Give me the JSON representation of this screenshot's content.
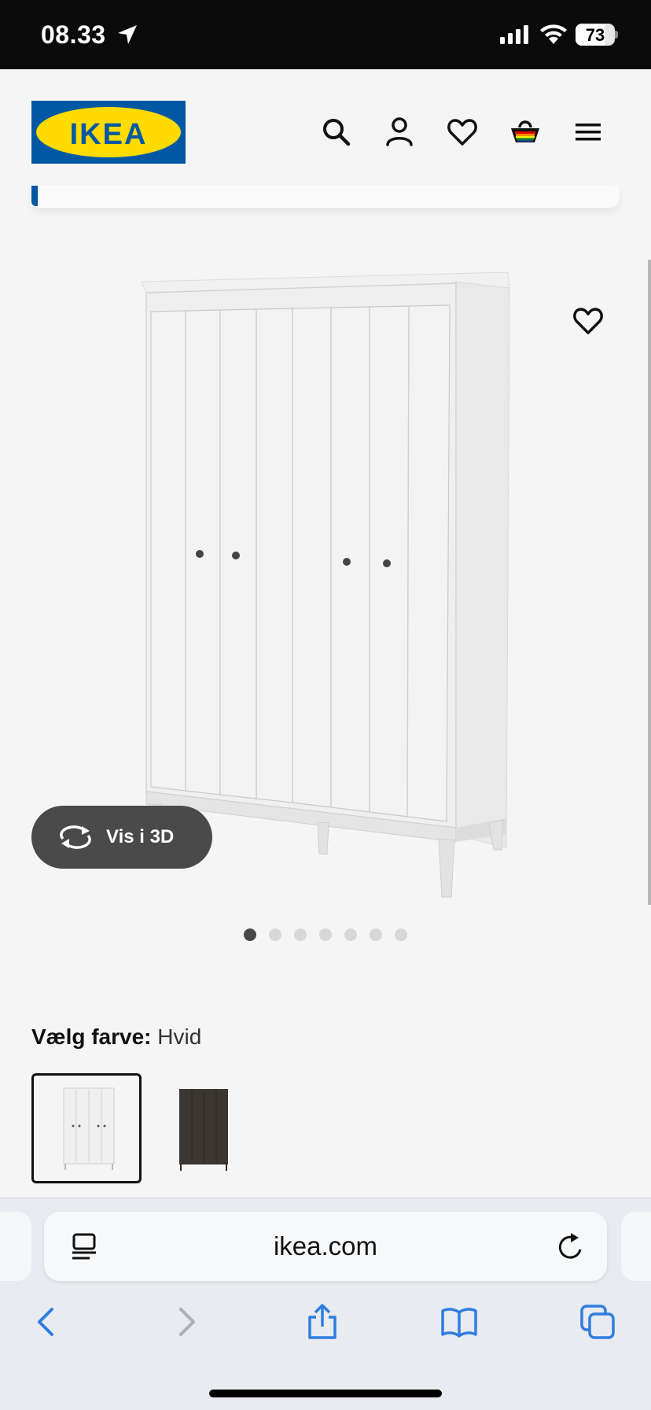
{
  "status_bar": {
    "time": "08.33",
    "battery": "73"
  },
  "header": {
    "logo_text": "IKEA"
  },
  "product": {
    "view_3d_label": "Vis i 3D",
    "image_count": 7,
    "active_image_index": 0
  },
  "color_selector": {
    "label": "Vælg farve:",
    "selected": "Hvid"
  },
  "browser": {
    "url": "ikea.com"
  },
  "icons": {
    "header": [
      "search-icon",
      "user-icon",
      "heart-icon",
      "cart-icon",
      "menu-icon"
    ],
    "toolbar": [
      "back-icon",
      "forward-icon",
      "share-icon",
      "bookmarks-icon",
      "tabs-icon"
    ]
  },
  "colors": {
    "ikea_blue": "#0058a3",
    "ikea_yellow": "#ffdb00",
    "safari_blue": "#2f7de1"
  }
}
